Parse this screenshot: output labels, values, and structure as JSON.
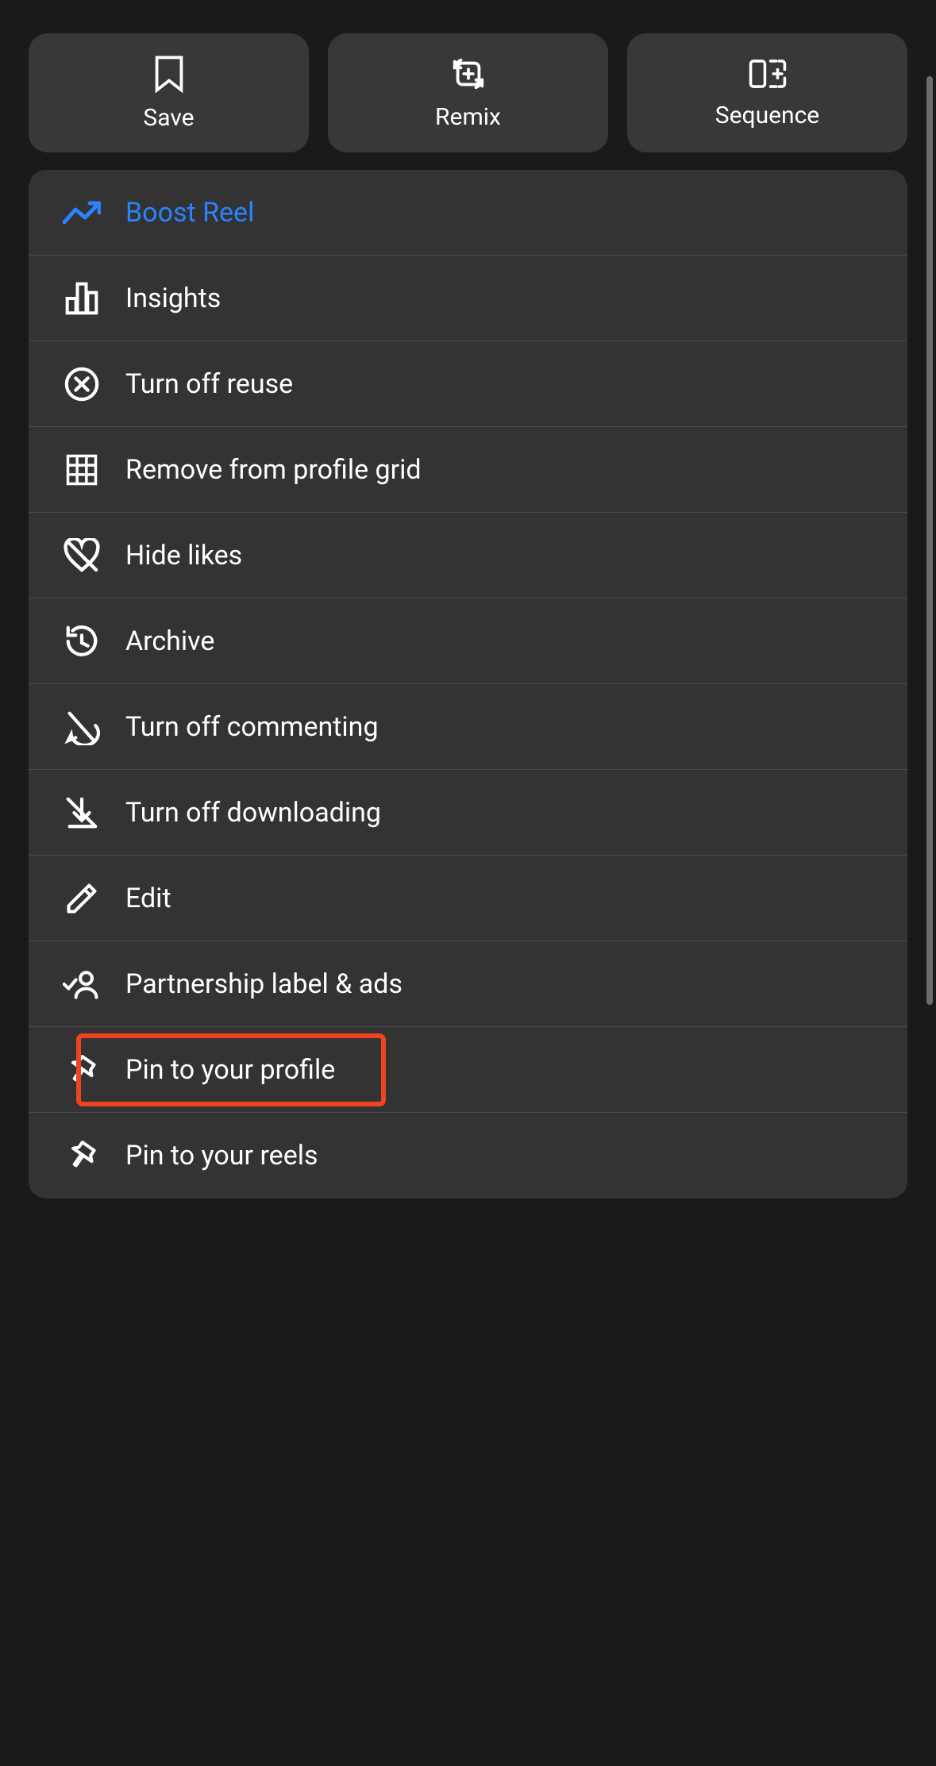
{
  "topActions": {
    "save": "Save",
    "remix": "Remix",
    "sequence": "Sequence"
  },
  "menu": {
    "boost": "Boost Reel",
    "insights": "Insights",
    "turnOffReuse": "Turn off reuse",
    "removeGrid": "Remove from profile grid",
    "hideLikes": "Hide likes",
    "archive": "Archive",
    "turnOffCommenting": "Turn off commenting",
    "turnOffDownloading": "Turn off downloading",
    "edit": "Edit",
    "partnership": "Partnership label & ads",
    "pinProfile": "Pin to your profile",
    "pinReels": "Pin to your reels"
  },
  "colors": {
    "accent": "#2b82ff",
    "highlight": "#ee4420",
    "cardBg": "#383838",
    "listBg": "#333333"
  }
}
